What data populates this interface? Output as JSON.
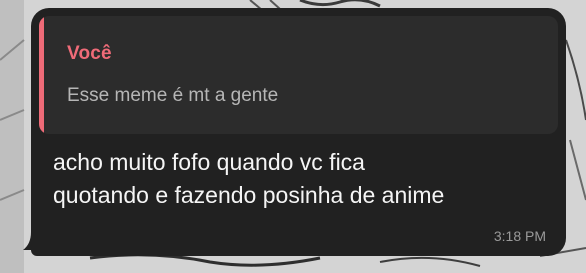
{
  "message": {
    "quote": {
      "author": "Você",
      "text": "Esse meme é mt a gente"
    },
    "text_line1": "acho muito fofo quando vc fica",
    "text_line2": "quotando e fazendo posinha de anime",
    "timestamp": "3:18 PM"
  },
  "colors": {
    "bubble": "#212121",
    "quote_background": "#2c2c2c",
    "quote_accent": "#ef6b78",
    "message_text": "#f5f5f5",
    "timestamp_text": "#9a9a9a"
  }
}
